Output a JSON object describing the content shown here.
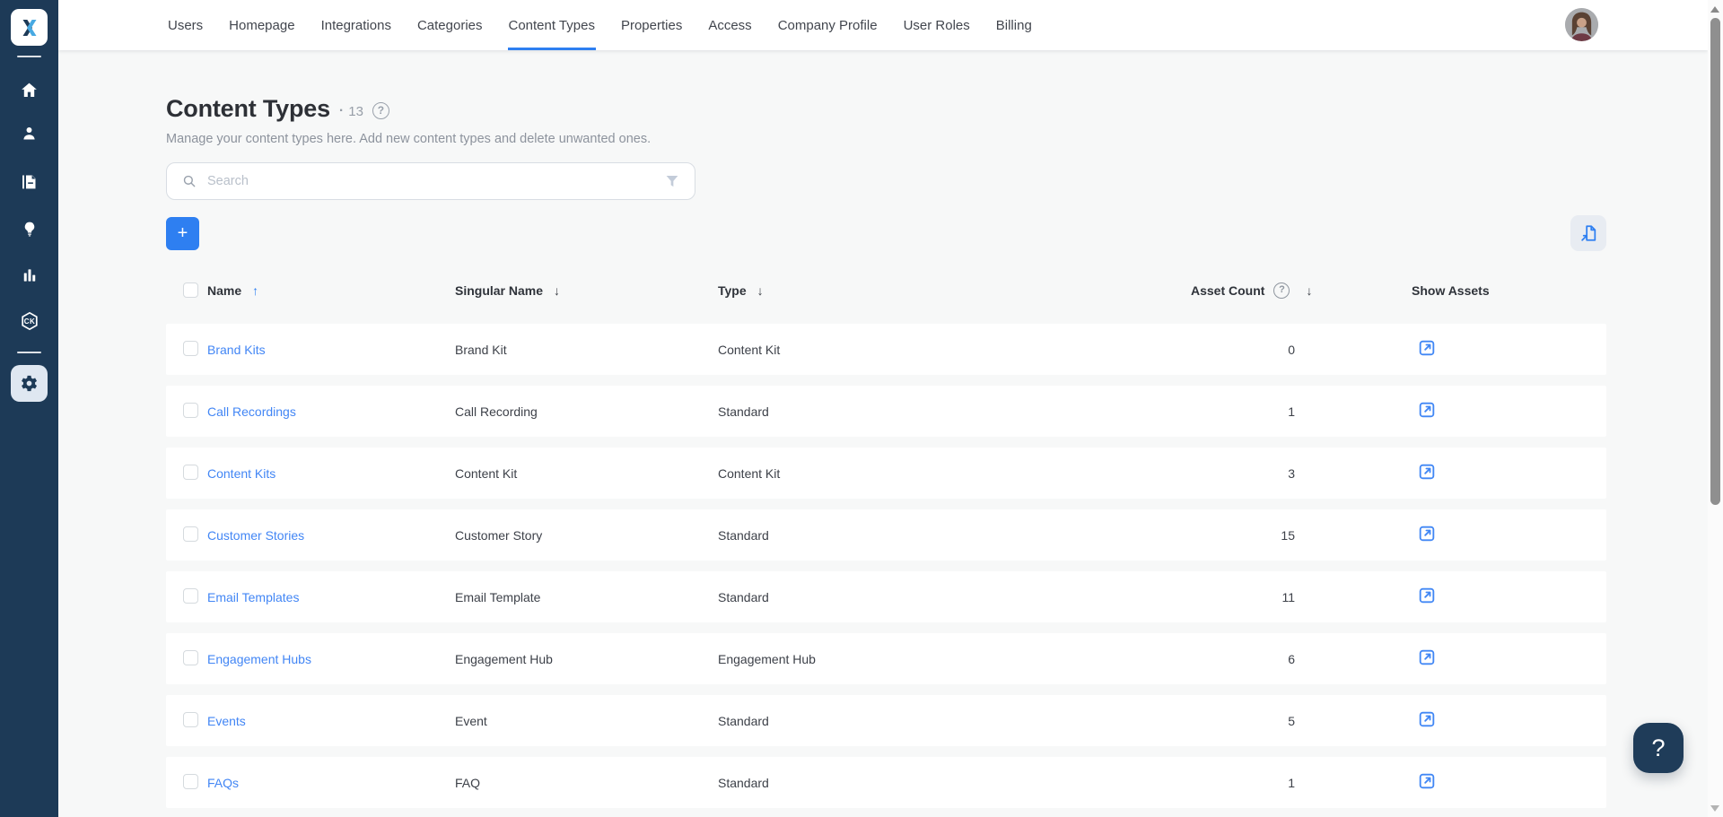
{
  "brand": {
    "sidebar_color": "#1d3a57",
    "accent_blue": "#2e7ff1",
    "link_blue": "#4286f5",
    "ck_badge": "CK"
  },
  "topnav": {
    "items": [
      {
        "label": "Users",
        "active": false
      },
      {
        "label": "Homepage",
        "active": false
      },
      {
        "label": "Integrations",
        "active": false
      },
      {
        "label": "Categories",
        "active": false
      },
      {
        "label": "Content Types",
        "active": true
      },
      {
        "label": "Properties",
        "active": false
      },
      {
        "label": "Access",
        "active": false
      },
      {
        "label": "Company Profile",
        "active": false
      },
      {
        "label": "User Roles",
        "active": false
      },
      {
        "label": "Billing",
        "active": false
      }
    ]
  },
  "page": {
    "title": "Content Types",
    "count_separator": "·",
    "count": "13",
    "subtitle": "Manage your content types here. Add new content types and delete unwanted ones."
  },
  "search": {
    "placeholder": "Search"
  },
  "icons": {
    "add": "+",
    "help": "?",
    "sort_asc": "↑",
    "sort_desc": "↓",
    "names": [
      "home-icon",
      "user-icon",
      "content-icon",
      "lightbulb-icon",
      "analytics-icon",
      "content-kit-icon",
      "settings-gear-icon",
      "search-icon",
      "filter-funnel-icon",
      "import-file-icon",
      "external-link-icon",
      "question-circle-icon"
    ]
  },
  "table": {
    "header": {
      "name": "Name",
      "singular_name": "Singular Name",
      "type": "Type",
      "asset_count": "Asset Count",
      "show_assets": "Show Assets",
      "sorted_by": "Name",
      "sort_direction": "asc"
    },
    "rows": [
      {
        "name": "Brand Kits",
        "singular": "Brand Kit",
        "type": "Content Kit",
        "count": "0"
      },
      {
        "name": "Call Recordings",
        "singular": "Call Recording",
        "type": "Standard",
        "count": "1"
      },
      {
        "name": "Content Kits",
        "singular": "Content Kit",
        "type": "Content Kit",
        "count": "3"
      },
      {
        "name": "Customer Stories",
        "singular": "Customer Story",
        "type": "Standard",
        "count": "15"
      },
      {
        "name": "Email Templates",
        "singular": "Email Template",
        "type": "Standard",
        "count": "11"
      },
      {
        "name": "Engagement Hubs",
        "singular": "Engagement Hub",
        "type": "Engagement Hub",
        "count": "6"
      },
      {
        "name": "Events",
        "singular": "Event",
        "type": "Standard",
        "count": "5"
      },
      {
        "name": "FAQs",
        "singular": "FAQ",
        "type": "Standard",
        "count": "1"
      }
    ]
  },
  "help_button": {
    "label": "?"
  }
}
